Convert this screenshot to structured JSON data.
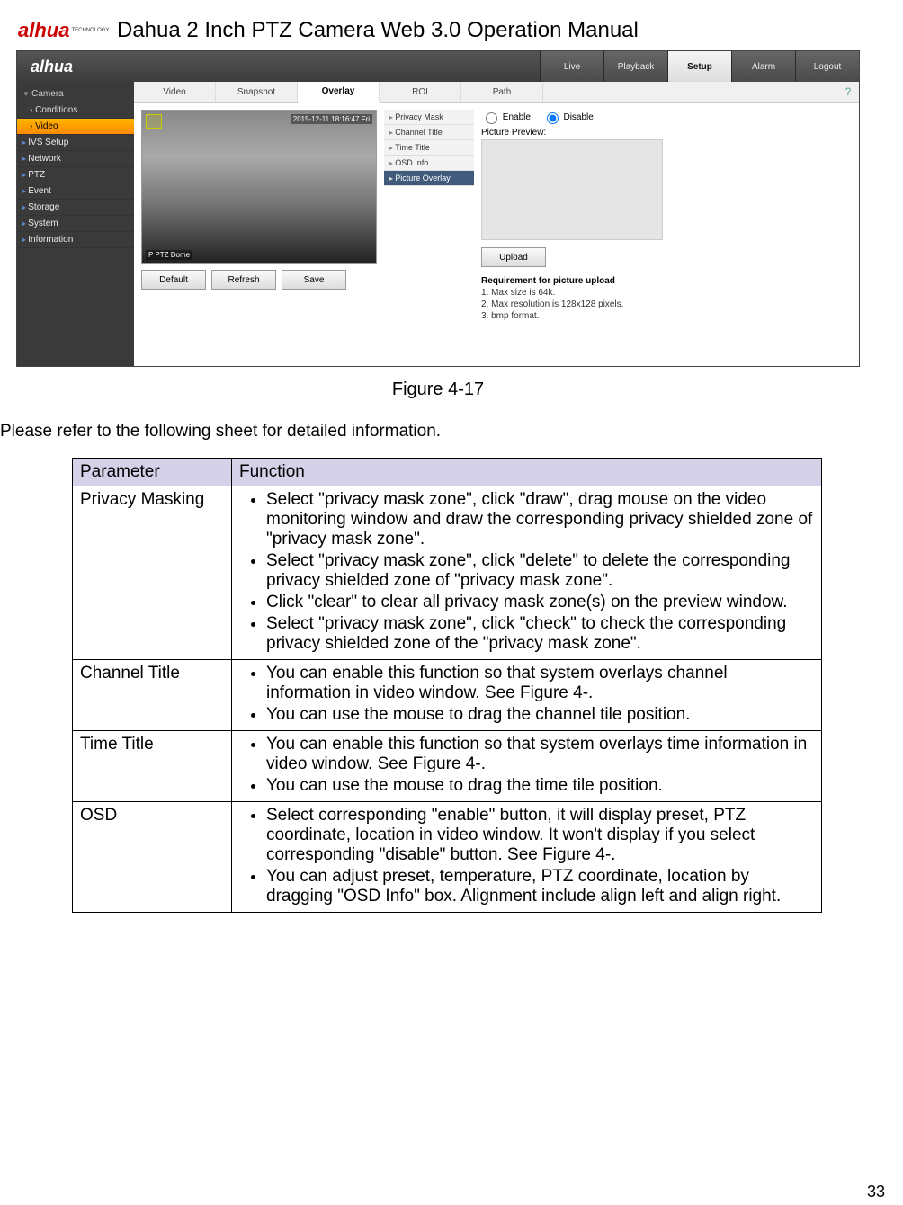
{
  "doc": {
    "title": "Dahua 2 Inch PTZ Camera Web 3.0 Operation Manual"
  },
  "logo": {
    "brand": "alhua",
    "tag": "TECHNOLOGY"
  },
  "figure": {
    "caption": "Figure 4-17"
  },
  "intro": "Please refer to the following sheet for detailed information.",
  "pagenum": "33",
  "screenshot": {
    "logo": "alhua",
    "toptabs": [
      {
        "label": "Live"
      },
      {
        "label": "Playback"
      },
      {
        "label": "Setup",
        "active": true
      },
      {
        "label": "Alarm"
      },
      {
        "label": "Logout"
      }
    ],
    "sidebar": {
      "head": "Camera",
      "sub": [
        {
          "label": "Conditions"
        },
        {
          "label": "Video",
          "hl": true
        }
      ],
      "top": [
        {
          "label": "IVS Setup"
        },
        {
          "label": "Network"
        },
        {
          "label": "PTZ"
        },
        {
          "label": "Event"
        },
        {
          "label": "Storage"
        },
        {
          "label": "System"
        },
        {
          "label": "Information"
        }
      ]
    },
    "subtabs": [
      {
        "label": "Video"
      },
      {
        "label": "Snapshot"
      },
      {
        "label": "Overlay",
        "active": true
      },
      {
        "label": "ROI"
      },
      {
        "label": "Path"
      }
    ],
    "preview": {
      "timestamp": "2015-12-11 18:16:47 Fri",
      "channel": "P PTZ Dome",
      "buttons": [
        "Default",
        "Refresh",
        "Save"
      ]
    },
    "midlist": [
      {
        "label": "Privacy Mask"
      },
      {
        "label": "Channel Title"
      },
      {
        "label": "Time Title"
      },
      {
        "label": "OSD Info"
      },
      {
        "label": "Picture Overlay",
        "sel": true
      }
    ],
    "right": {
      "enable": "Enable",
      "disable": "Disable",
      "picture_preview": "Picture Preview:",
      "upload": "Upload",
      "req_head": "Requirement for picture upload",
      "req1": "1. Max size is 64k.",
      "req2": "2. Max resolution is 128x128 pixels.",
      "req3": "3. bmp format."
    }
  },
  "table": {
    "headers": [
      "Parameter",
      "Function"
    ],
    "rows": [
      {
        "param": "Privacy Masking",
        "items": [
          "Select \"privacy mask zone\", click \"draw\", drag mouse on the video monitoring window and draw the corresponding privacy shielded zone of \"privacy mask zone\".",
          "Select \"privacy mask zone\", click \"delete\" to delete the corresponding privacy shielded zone of \"privacy mask zone\".",
          "Click \"clear\" to clear all privacy mask zone(s) on the preview window.",
          "Select \"privacy mask zone\", click \"check\" to check the corresponding privacy shielded zone of the \"privacy mask zone\"."
        ]
      },
      {
        "param": "Channel Title",
        "items": [
          "You can enable this function so that system overlays channel information in video window. See Figure 4-.",
          "You can use the mouse to drag the channel tile position."
        ]
      },
      {
        "param": "Time Title",
        "items": [
          "You can enable this function so that system overlays time information in video window. See Figure 4-.",
          "You can use the mouse to drag the time tile position."
        ]
      },
      {
        "param": "OSD",
        "items": [
          "Select corresponding \"enable\" button, it will display preset, PTZ coordinate, location in video window. It won't display if you select corresponding \"disable\" button. See Figure 4-.",
          "You can adjust preset, temperature, PTZ coordinate, location by dragging \"OSD Info\" box. Alignment include align left and align right."
        ]
      }
    ]
  }
}
